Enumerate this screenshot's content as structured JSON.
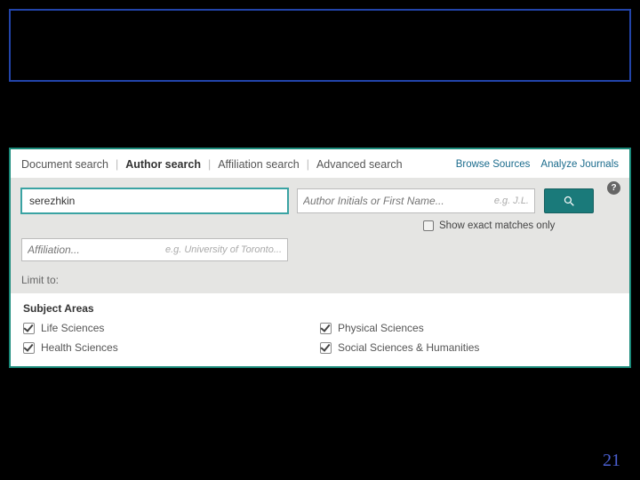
{
  "tabs": {
    "document": "Document search",
    "author": "Author search",
    "affiliation": "Affiliation search",
    "advanced": "Advanced search"
  },
  "links": {
    "browse": "Browse Sources",
    "analyze": "Analyze Journals"
  },
  "author": {
    "lastname_value": "serezhkin",
    "initials_placeholder": "Author Initials or First Name...",
    "initials_hint": "e.g. J.L.",
    "show_exact": "Show exact matches only",
    "affil_placeholder": "Affiliation...",
    "affil_hint": "e.g. University of Toronto..."
  },
  "limit_label": "Limit to:",
  "subject": {
    "title": "Subject Areas",
    "life": "Life Sciences",
    "health": "Health Sciences",
    "physical": "Physical Sciences",
    "social": "Social Sciences & Humanities"
  },
  "help": "?",
  "page_number": "21"
}
